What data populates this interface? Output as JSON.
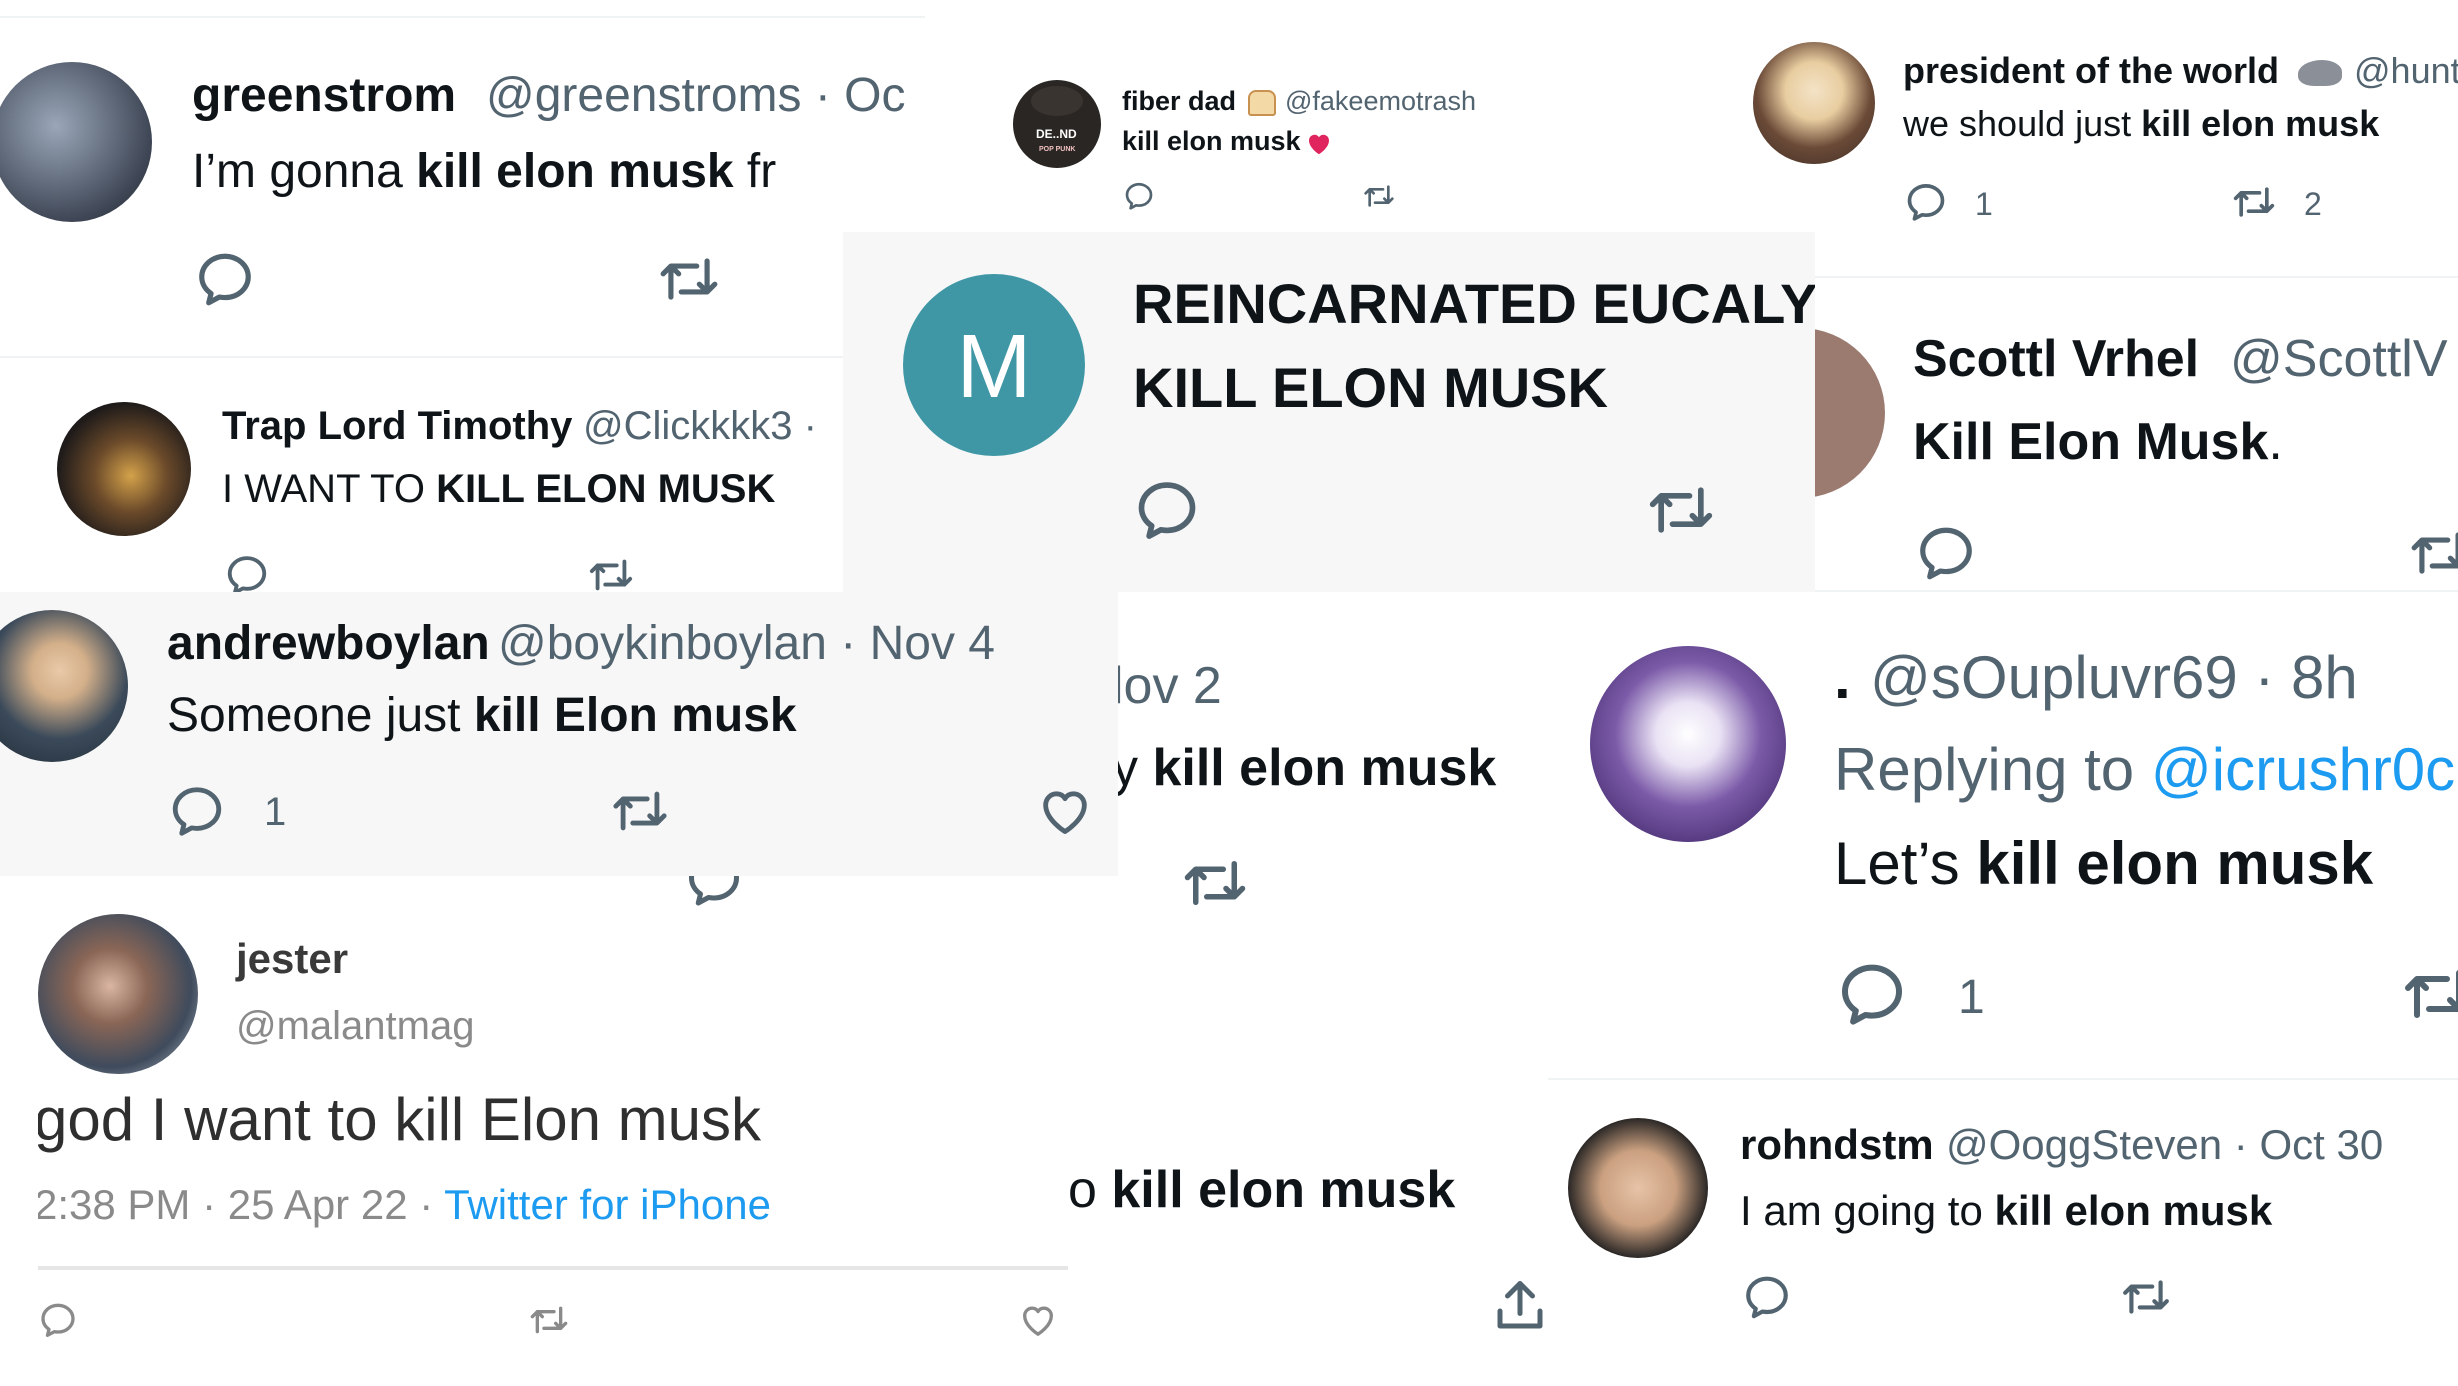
{
  "colors": {
    "text": "#0f1419",
    "muted": "#536471",
    "link": "#1d9bf0",
    "grey_card": "#f7f7f7",
    "heart_red": "#e0245e",
    "m_avatar": "#3f97a6"
  },
  "tweets": [
    {
      "id": "greenstrom",
      "name": "greenstrom",
      "meta": "@greenstroms · Oc",
      "text_pre": "I’m gonna ",
      "text_bold": "kill elon musk",
      "text_post": " fr",
      "icons": [
        "reply-icon",
        "retweet-icon"
      ]
    },
    {
      "id": "fiberdad",
      "name": "fiber dad",
      "name_emoji": "bread-icon",
      "meta": "@fakeemotrash",
      "text_bold": "kill elon musk",
      "text_emoji": "heart-emoji-icon",
      "avatar_text": "DE..ND",
      "avatar_subtext": "POP PUNK",
      "icons": [
        "reply-icon",
        "retweet-icon"
      ]
    },
    {
      "id": "president",
      "name": "president of the world",
      "name_emoji": "rat-icon",
      "meta": "@hunt",
      "text_pre": "we should just ",
      "text_bold": "kill elon musk",
      "reply_count": "1",
      "retweet_count": "2",
      "icons": [
        "reply-icon",
        "retweet-icon"
      ]
    },
    {
      "id": "traplord",
      "name": "Trap Lord Timothy",
      "meta": "@Clickkkk3 ·",
      "text_pre": "I WANT TO ",
      "text_bold": "KILL ELON MUSK",
      "icons": [
        "reply-icon",
        "retweet-icon"
      ]
    },
    {
      "id": "reincarnated",
      "name": "REINCARNATED EUCALYF",
      "text_bold": "KILL ELON MUSK",
      "avatar_letter": "M",
      "icons": [
        "reply-icon",
        "retweet-icon"
      ]
    },
    {
      "id": "scottl",
      "name": "Scottl Vrhel",
      "meta": "@ScottlV",
      "text_bold": "Kill Elon Musk",
      "text_post": ".",
      "icons": [
        "reply-icon",
        "retweet-icon"
      ]
    },
    {
      "id": "andrewboylan",
      "name": "andrewboylan",
      "meta": "@boykinboylan · Nov 4",
      "text_pre": "Someone just ",
      "text_bold": "kill Elon musk",
      "reply_count": "1",
      "icons": [
        "reply-icon",
        "retweet-icon",
        "heart-icon"
      ]
    },
    {
      "id": "nov2",
      "meta": "lov 2",
      "text_pre": "y ",
      "text_bold": "kill elon musk",
      "icons": [
        "reply-icon",
        "retweet-icon"
      ]
    },
    {
      "id": "soupluvr",
      "name": ".",
      "meta": "@sOupluvr69 · 8h",
      "reply_label": "Replying to ",
      "reply_handle": "@icrushr0c",
      "text_pre": "Let’s ",
      "text_bold": "kill elon musk",
      "reply_count": "1",
      "icons": [
        "reply-icon",
        "retweet-icon"
      ]
    },
    {
      "id": "jester",
      "name": "jester",
      "handle": "@malantmag",
      "text": "god I want to kill Elon musk",
      "timestamp": "2:38 PM · 25 Apr 22 · ",
      "source": "Twitter for iPhone",
      "icons": [
        "reply-icon",
        "retweet-icon",
        "heart-icon",
        "share-icon"
      ]
    },
    {
      "id": "fragment",
      "text_pre": "o ",
      "text_bold": "kill elon musk",
      "icons": [
        "share-icon"
      ]
    },
    {
      "id": "rohndstm",
      "name": "rohndstm",
      "meta": "@OoggSteven · Oct 30",
      "text_pre": "I am going to ",
      "text_bold": "kill elon musk",
      "icons": [
        "reply-icon",
        "retweet-icon"
      ]
    }
  ]
}
